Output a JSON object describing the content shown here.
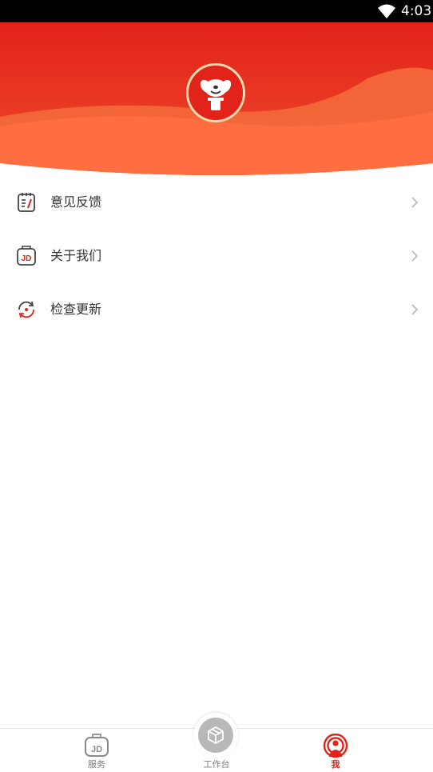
{
  "status_bar": {
    "time": "4:03",
    "wifi_icon": "wifi-icon"
  },
  "header": {
    "avatar_icon": "jd-dog-mascot-icon",
    "colors": {
      "top": "#e2231a",
      "bottom": "#ff6a3d"
    }
  },
  "menu": {
    "items": [
      {
        "label": "意见反馈",
        "icon": "feedback-icon"
      },
      {
        "label": "关于我们",
        "icon": "jd-logo-icon"
      },
      {
        "label": "检查更新",
        "icon": "refresh-icon"
      }
    ]
  },
  "tabbar": {
    "tabs": [
      {
        "label": "服务",
        "icon": "jd-service-icon",
        "active": false
      },
      {
        "label": "工作台",
        "icon": "box-icon",
        "active": false
      },
      {
        "label": "我",
        "icon": "user-profile-icon",
        "active": true
      }
    ]
  },
  "colors": {
    "accent": "#e2231a",
    "text": "#333333",
    "muted": "#7a7a7a"
  }
}
